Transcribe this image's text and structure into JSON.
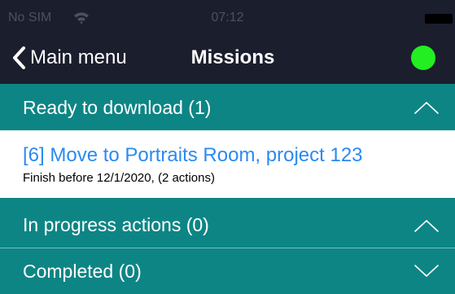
{
  "status_bar": {
    "carrier": "No SIM",
    "time": "07:12"
  },
  "nav": {
    "back_label": "Main menu",
    "title": "Missions",
    "status_color": "#22ee22"
  },
  "colors": {
    "bar": "#1b1e2d",
    "section": "#0e8585",
    "link": "#2b8af0"
  },
  "sections": [
    {
      "label": "Ready to download (1)",
      "expanded": true,
      "icon": "chevron-up-icon",
      "items": [
        {
          "title": "[6] Move to Portraits Room, project 123",
          "subtitle": "Finish before 12/1/2020, (2 actions)"
        }
      ]
    },
    {
      "label": "In progress actions (0)",
      "expanded": true,
      "icon": "chevron-up-icon",
      "items": []
    },
    {
      "label": "Completed (0)",
      "expanded": false,
      "icon": "chevron-down-icon",
      "items": []
    }
  ]
}
